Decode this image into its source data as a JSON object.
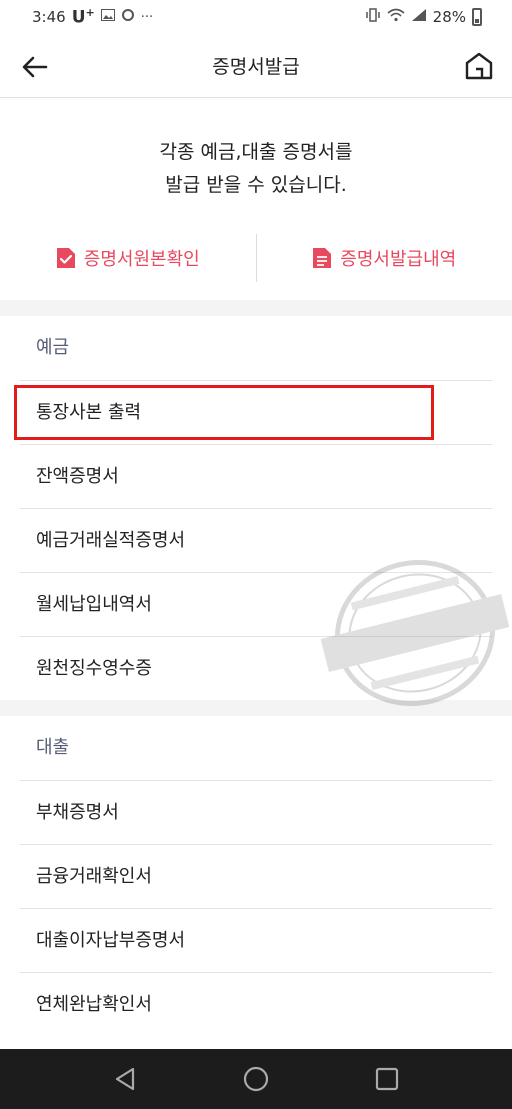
{
  "status_bar": {
    "time": "3:46",
    "carrier": "U",
    "carrier_sup": "+",
    "dots": "···",
    "battery": "28%"
  },
  "header": {
    "title": "증명서발급"
  },
  "intro": {
    "line1": "각종 예금,대출 증명서를",
    "line2": "발급 받을 수 있습니다."
  },
  "actions": {
    "original_check": "증명서원본확인",
    "issue_history": "증명서발급내역"
  },
  "sections": {
    "deposit": {
      "title": "예금",
      "items": [
        "통장사본 출력",
        "잔액증명서",
        "예금거래실적증명서",
        "월세납입내역서",
        "원천징수영수증"
      ]
    },
    "loan": {
      "title": "대출",
      "items": [
        "부채증명서",
        "금융거래확인서",
        "대출이자납부증명서",
        "연체완납확인서"
      ]
    }
  },
  "colors": {
    "accent": "#e8495f",
    "highlight": "#e21b1b",
    "section_title": "#555e78"
  }
}
